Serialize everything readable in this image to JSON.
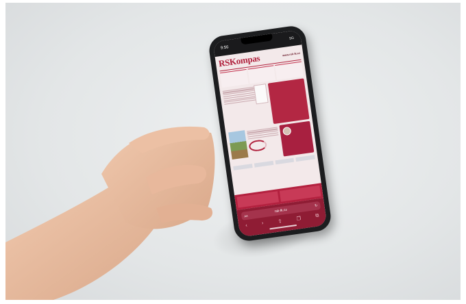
{
  "phone": {
    "time": "9:56",
    "signal": "5G",
    "logo": "RSKompas",
    "header_url": "www.rsk-lk.cz",
    "browser_address": "rsk-lk.cz",
    "text_size_button": "AA",
    "reload_icon": "reload-icon",
    "nav_icons": [
      "back-icon",
      "forward-icon",
      "share-icon",
      "bookmarks-icon",
      "tabs-icon"
    ]
  },
  "colors": {
    "accent": "#b0203c",
    "browser_bar": "#8f1c34",
    "background": "#e3e6e7"
  }
}
